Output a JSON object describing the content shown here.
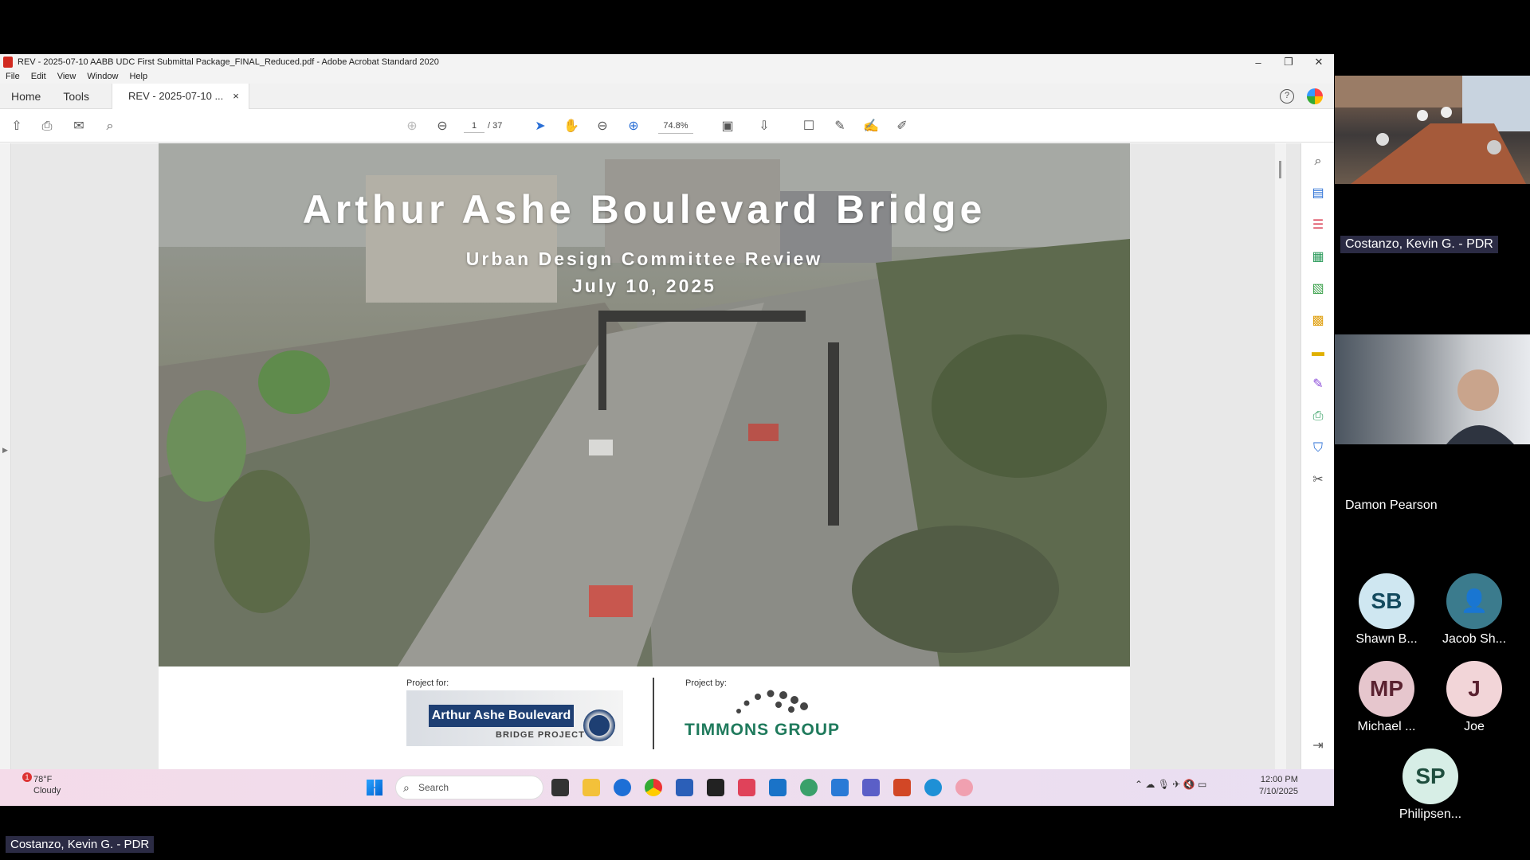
{
  "window": {
    "title": "REV - 2025-07-10 AABB UDC First Submittal Package_FINAL_Reduced.pdf - Adobe Acrobat Standard 2020",
    "minimize": "–",
    "maximize": "❐",
    "close": "✕"
  },
  "menu": [
    "File",
    "Edit",
    "View",
    "Window",
    "Help"
  ],
  "tabs": {
    "home": "Home",
    "tools": "Tools",
    "document": "REV - 2025-07-10 ...",
    "close": "×"
  },
  "toolbar": {
    "page_current": "1",
    "page_total": "/ 37",
    "zoom": "74.8%"
  },
  "document": {
    "title": "Arthur Ashe Boulevard Bridge",
    "subtitle": "Urban Design Committee Review",
    "date": "July 10, 2025",
    "project_for_label": "Project for:",
    "project_by_label": "Project by:",
    "client_logo_text": "Arthur Ashe Boulevard",
    "client_logo_sub": "BRIDGE PROJECT",
    "firm_name": "TIMMONS GROUP"
  },
  "taskbar": {
    "temperature": "78°F",
    "condition": "Cloudy",
    "badge": "1",
    "search_placeholder": "Search",
    "time": "12:00 PM",
    "date": "7/10/2025"
  },
  "meeting": {
    "speaker_label": "Costanzo, Kevin G. - PDR",
    "video1_name": "Costanzo, Kevin G. - PDR",
    "video2_name": "Damon Pearson",
    "participants": [
      {
        "initials": "SB",
        "name": "Shawn B..."
      },
      {
        "initials": "",
        "name": "Jacob Sh..."
      },
      {
        "initials": "MP",
        "name": "Michael ..."
      },
      {
        "initials": "J",
        "name": "Joe"
      },
      {
        "initials": "SP",
        "name": "Philipsen..."
      }
    ]
  },
  "colors": {
    "acrobat_red": "#d12a20",
    "timmons_green": "#1f7a5c",
    "aabb_blue": "#1e3f73"
  }
}
